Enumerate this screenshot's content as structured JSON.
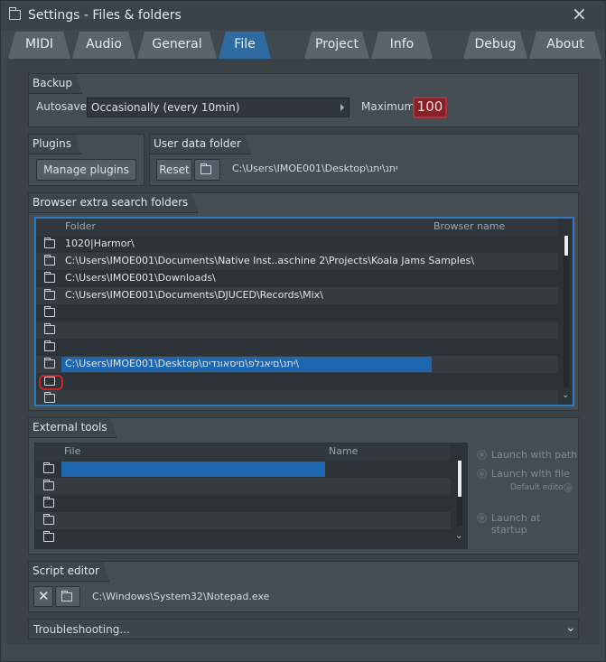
{
  "window": {
    "title": "Settings - Files & folders",
    "close_glyph": "×"
  },
  "tabs": [
    {
      "label": "MIDI"
    },
    {
      "label": "Audio"
    },
    {
      "label": "General"
    },
    {
      "label": "File",
      "active": true
    },
    {
      "label": "Project"
    },
    {
      "label": "Info"
    },
    {
      "label": "Debug"
    },
    {
      "label": "About"
    }
  ],
  "backup": {
    "section_title": "Backup",
    "autosave_label": "Autosave",
    "autosave_value": "Occasionally (every 10min)",
    "maximum_label": "Maximum",
    "maximum_value": "100"
  },
  "plugins": {
    "section_title": "Plugins",
    "manage_button": "Manage plugins"
  },
  "user_data": {
    "section_title": "User data folder",
    "reset_button": "Reset",
    "path": "C:\\Users\\IMOE001\\Desktop\\יתנ\\יתנ"
  },
  "browser_folders": {
    "section_title": "Browser extra search folders",
    "col_folder": "Folder",
    "col_browser_name": "Browser name",
    "rows": [
      {
        "folder": "1020|Harmor\\"
      },
      {
        "folder": "C:\\Users\\IMOE001\\Documents\\Native Inst..aschine 2\\Projects\\Koala Jams Samples\\"
      },
      {
        "folder": "C:\\Users\\IMOE001\\Downloads\\"
      },
      {
        "folder": "C:\\Users\\IMOE001\\Documents\\DJUCED\\Records\\Mix\\"
      },
      {
        "folder": ""
      },
      {
        "folder": ""
      },
      {
        "folder": ""
      },
      {
        "folder": "C:\\Users\\IMOE001\\Desktop\\יתנ\\םיאנלפ\\םיסאונדים\\",
        "selected": true
      },
      {
        "folder": ""
      },
      {
        "folder": ""
      }
    ]
  },
  "external_tools": {
    "section_title": "External tools",
    "col_file": "File",
    "col_name": "Name",
    "rows": [
      {
        "file": "",
        "selected": true
      },
      {
        "file": ""
      },
      {
        "file": ""
      },
      {
        "file": ""
      },
      {
        "file": ""
      }
    ],
    "launch_with_path": "Launch with path",
    "launch_with_file": "Launch with file",
    "default_editor": "Default editor",
    "launch_at_startup": "Launch at startup"
  },
  "script_editor": {
    "section_title": "Script editor",
    "path": "C:\\Windows\\System32\\Notepad.exe"
  },
  "troubleshooting": {
    "label": "Troubleshooting..."
  }
}
